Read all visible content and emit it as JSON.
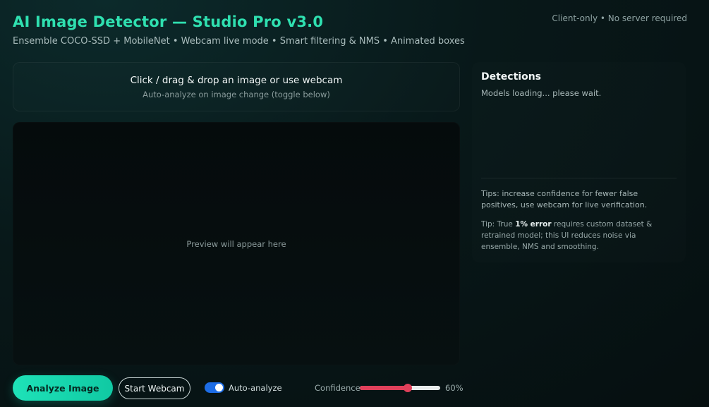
{
  "header": {
    "title": "AI Image Detector — Studio Pro v3.0",
    "subtitle": "Ensemble COCO-SSD + MobileNet • Webcam live mode • Smart filtering & NMS • Animated boxes",
    "note": "Client-only • No server required"
  },
  "dropzone": {
    "title": "Click / drag & drop an image or use webcam",
    "subtitle": "Auto-analyze on image change (toggle below)"
  },
  "preview": {
    "placeholder": "Preview will appear here"
  },
  "detections": {
    "title": "Detections",
    "status": "Models loading... please wait.",
    "tip1": "Tips: increase confidence for fewer false positives, use webcam for live verification.",
    "tip2_prefix": "Tip: True ",
    "tip2_bold": "1% error",
    "tip2_suffix": " requires custom dataset & retrained model; this UI reduces noise via ensemble, NMS and smoothing."
  },
  "controls": {
    "analyze_label": "Analyze Image",
    "webcam_label": "Start Webcam",
    "auto_analyze_label": "Auto-analyze",
    "auto_analyze_on": true,
    "confidence_label": "Confidence",
    "confidence_value": 60,
    "confidence_text": "60%"
  },
  "colors": {
    "accent": "#2fe0b0",
    "toggle": "#1d6de6",
    "slider": "#e0405a"
  }
}
